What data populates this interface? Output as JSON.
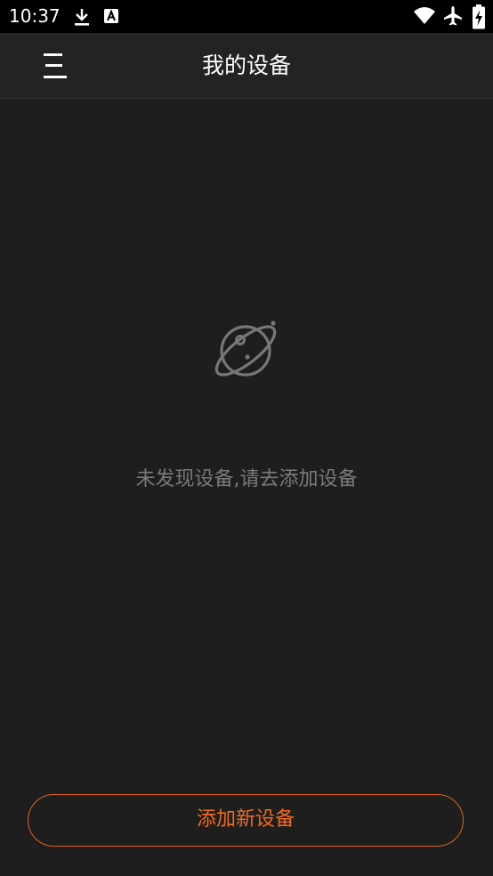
{
  "status_bar": {
    "time": "10:37",
    "icons": [
      "download-icon",
      "a-badge-icon",
      "wifi-icon",
      "airplane-icon",
      "battery-charging-icon"
    ]
  },
  "header": {
    "title": "我的设备",
    "menu_icon": "menu-icon"
  },
  "empty_state": {
    "icon": "planet-icon",
    "message": "未发现设备,请去添加设备"
  },
  "add_button": {
    "label": "添加新设备"
  },
  "colors": {
    "background": "#1e1e1e",
    "header": "#232323",
    "status_bar": "#000000",
    "accent": "#f26b1d",
    "muted_text": "#7a7a7a"
  }
}
